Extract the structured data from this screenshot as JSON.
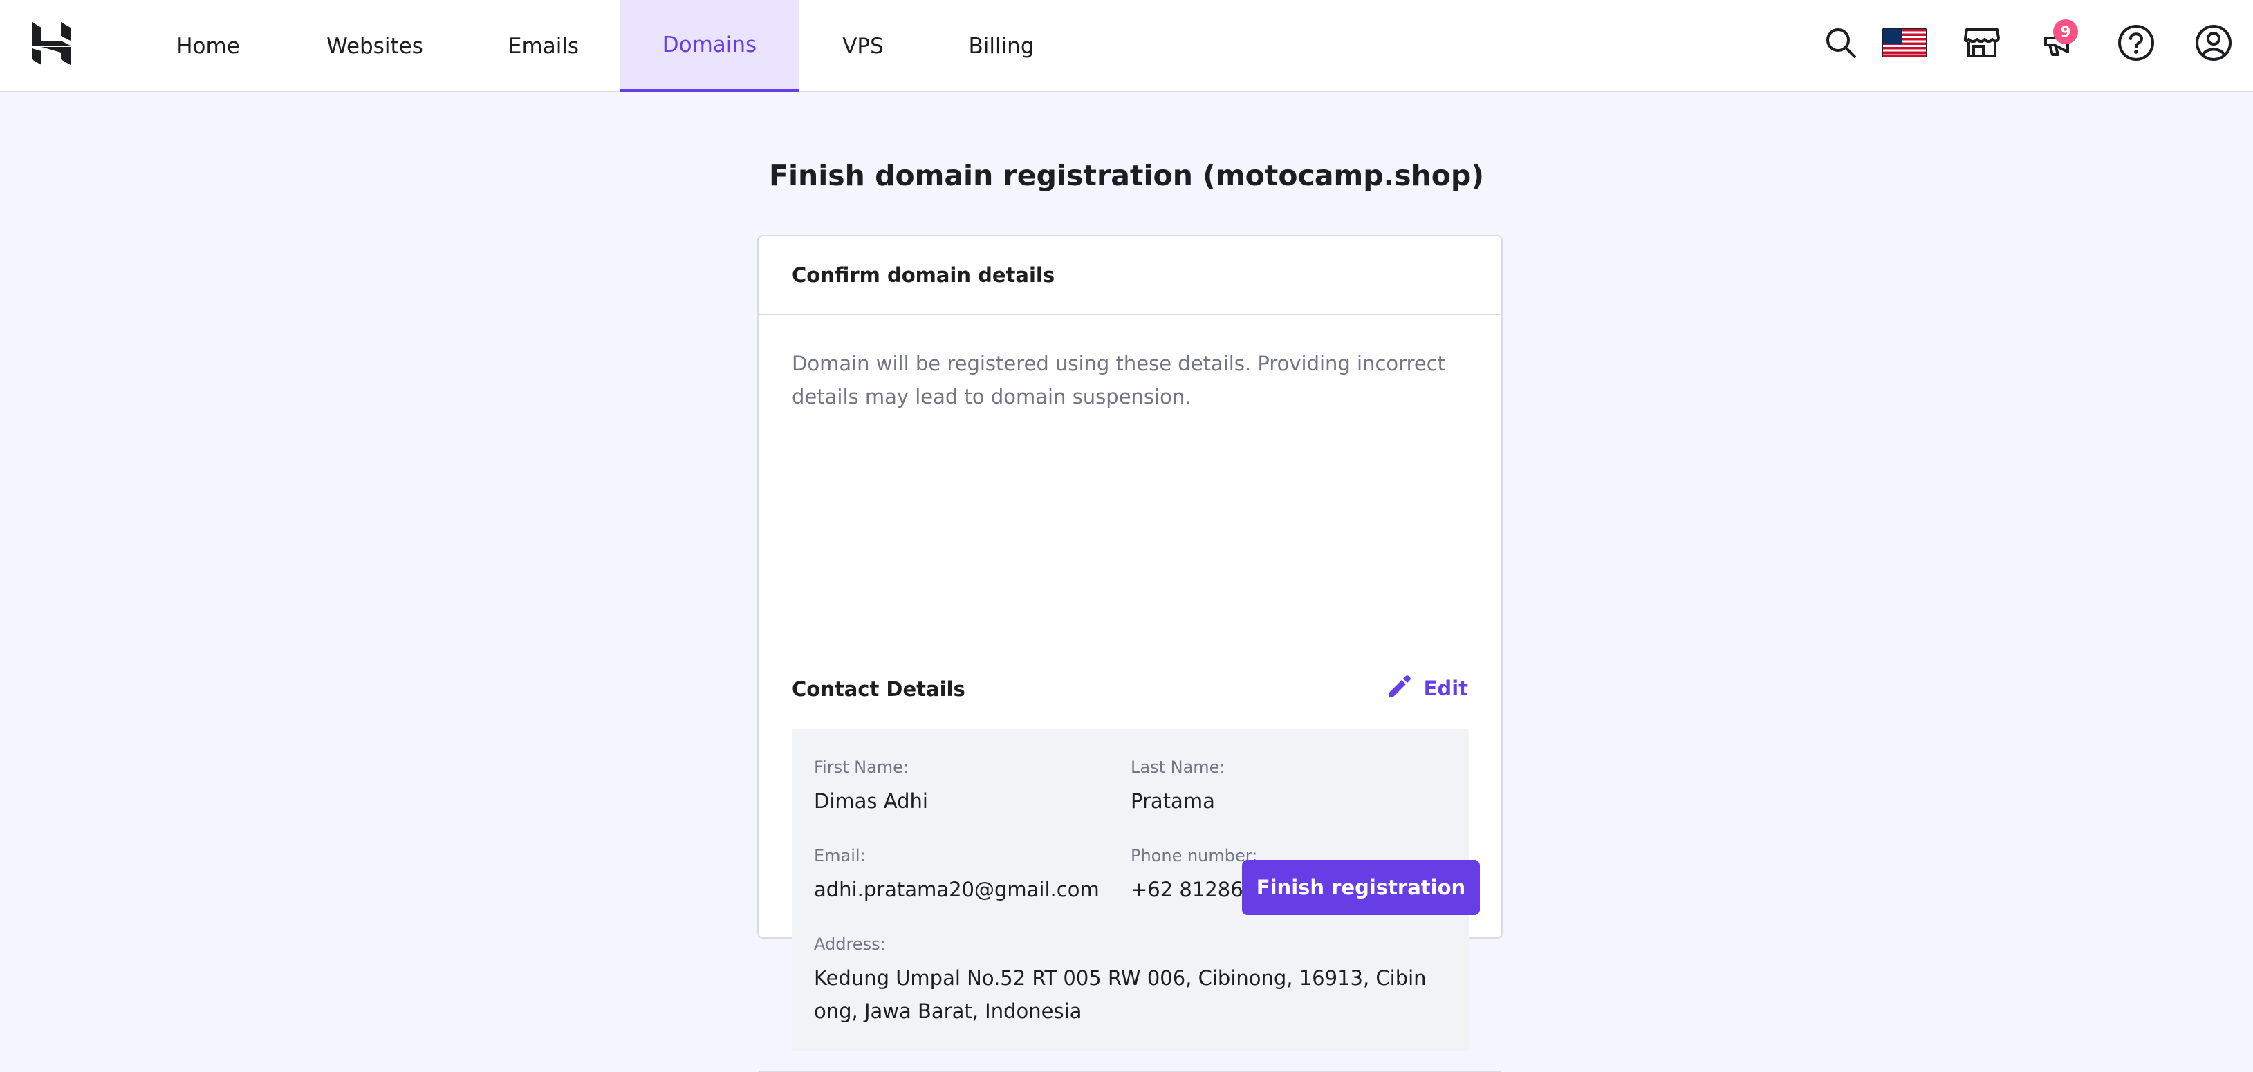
{
  "nav": {
    "items": [
      {
        "label": "Home"
      },
      {
        "label": "Websites"
      },
      {
        "label": "Emails"
      },
      {
        "label": "Domains",
        "active": true
      },
      {
        "label": "VPS"
      },
      {
        "label": "Billing"
      }
    ]
  },
  "header_icons": {
    "notifications_count": "9"
  },
  "page": {
    "title": "Finish domain registration (motocamp.shop)"
  },
  "card": {
    "header": "Confirm domain details",
    "description": "Domain will be registered using these details. Providing incorrect details may lead to domain suspension.",
    "contact_title": "Contact Details",
    "edit_label": "Edit",
    "fields": {
      "first_name_label": "First Name:",
      "first_name": "Dimas Adhi",
      "last_name_label": "Last Name:",
      "last_name": "Pratama",
      "email_label": "Email:",
      "email": "adhi.pratama20@gmail.com",
      "phone_label": "Phone number:",
      "phone": "+62 81286668727",
      "address_label": "Address:",
      "address": "Kedung Umpal No.52 RT 005 RW 006, Cibinong, 16913, Cibinong, Jawa Barat, Indonesia"
    },
    "finish_label": "Finish registration"
  },
  "colors": {
    "accent": "#673de6",
    "background": "#f4f5ff",
    "badge": "#fc5185"
  }
}
